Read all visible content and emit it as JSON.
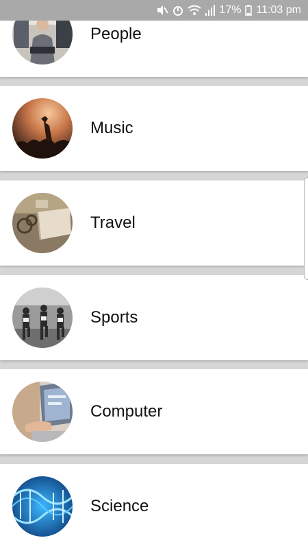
{
  "status_bar": {
    "battery_percent": "17%",
    "time": "11:03 pm",
    "icons": [
      "mute-icon",
      "alarm-icon",
      "wifi-icon",
      "signal-icon",
      "battery-icon"
    ]
  },
  "categories": [
    {
      "label": "People",
      "icon": "people-photo"
    },
    {
      "label": "Music",
      "icon": "music-photo"
    },
    {
      "label": "Travel",
      "icon": "travel-photo"
    },
    {
      "label": "Sports",
      "icon": "sports-photo"
    },
    {
      "label": "Computer",
      "icon": "computer-photo"
    },
    {
      "label": "Science",
      "icon": "science-photo"
    }
  ],
  "colors": {
    "status_bar_bg": "#a9a9a9",
    "card_bg": "#ffffff",
    "divider_bg": "#d6d6d6",
    "text": "#111111"
  }
}
